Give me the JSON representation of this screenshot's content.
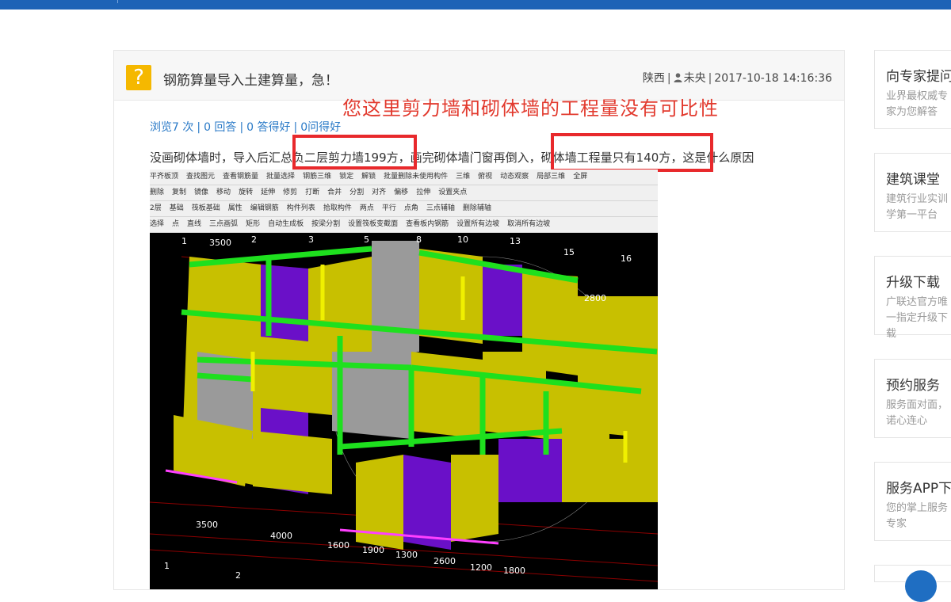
{
  "question": {
    "icon": "question-mark-icon",
    "title": "钢筋算量导入土建算量，急！",
    "region": "陕西",
    "author": "未央",
    "datetime": "2017-10-18 14:16:36"
  },
  "annotation": {
    "red_title": "您这里剪力墙和砌体墙的工程量没有可比性"
  },
  "stats": {
    "views": "浏览7 次",
    "answers": "0 回答",
    "good_answers": "0 答得好",
    "good_questions": "0问得好"
  },
  "body": {
    "text_a": "没画砌体墙时，导入后汇",
    "text_b": "总负二层剪力墙199方",
    "text_c": "，画完砌体墙门窗再倒入",
    "text_d": "，砌体墙工程量只有140方",
    "text_e": "，这是什么原因"
  },
  "software": {
    "toolbar1": [
      "平齐板顶",
      "查找图元",
      "查看钢筋量",
      "批量选择",
      "钢筋三维",
      "锁定",
      "解锁",
      "批量删除未使用构件",
      "三维",
      "俯视",
      "动态观察",
      "局部三维",
      "全屏"
    ],
    "toolbar2": [
      "删除",
      "复制",
      "镜像",
      "移动",
      "旋转",
      "延伸",
      "修剪",
      "打断",
      "合并",
      "分割",
      "对齐",
      "偏移",
      "拉伸",
      "设置夹点"
    ],
    "toolbar3": [
      "2层",
      "基础",
      "筏板基础",
      "属性",
      "编辑钢筋",
      "构件列表",
      "拾取构件",
      "两点",
      "平行",
      "点角",
      "三点辅轴",
      "删除辅轴"
    ],
    "toolbar4": [
      "选择",
      "点",
      "直线",
      "三点画弧",
      "矩形",
      "自动生成板",
      "按梁分割",
      "设置筏板变截面",
      "查看板内钢筋",
      "设置所有边坡",
      "取消所有边坡"
    ],
    "axis_top": [
      "1",
      "3500",
      "2",
      "3",
      "5",
      "8",
      "10",
      "13",
      "15",
      "16",
      "2800"
    ],
    "axis_bottom": [
      "3500",
      "4000",
      "1600",
      "1900",
      "1300",
      "2600",
      "1200",
      "1800",
      "1",
      "2"
    ]
  },
  "sidebar": [
    {
      "title": "向专家提问",
      "desc": "业界最权威专家为您解答"
    },
    {
      "title": "建筑课堂",
      "desc": "建筑行业实训学第一平台"
    },
    {
      "title": "升级下载",
      "desc": "广联达官方唯一指定升级下载"
    },
    {
      "title": "预约服务",
      "desc": "服务面对面，诺心连心"
    },
    {
      "title": "服务APP下载",
      "desc": "您的掌上服务专家"
    }
  ],
  "colors": {
    "header_blue": "#1d63b6",
    "annotation_red": "#e23a2e",
    "box_red": "#e8292c",
    "link_blue": "#2a7ac7",
    "question_yellow": "#f5b800",
    "wall_yellow": "#c8c000",
    "wall_purple": "#6a10c8",
    "beam_green": "#1ee01e",
    "wall_gray": "#9a9a9a"
  }
}
